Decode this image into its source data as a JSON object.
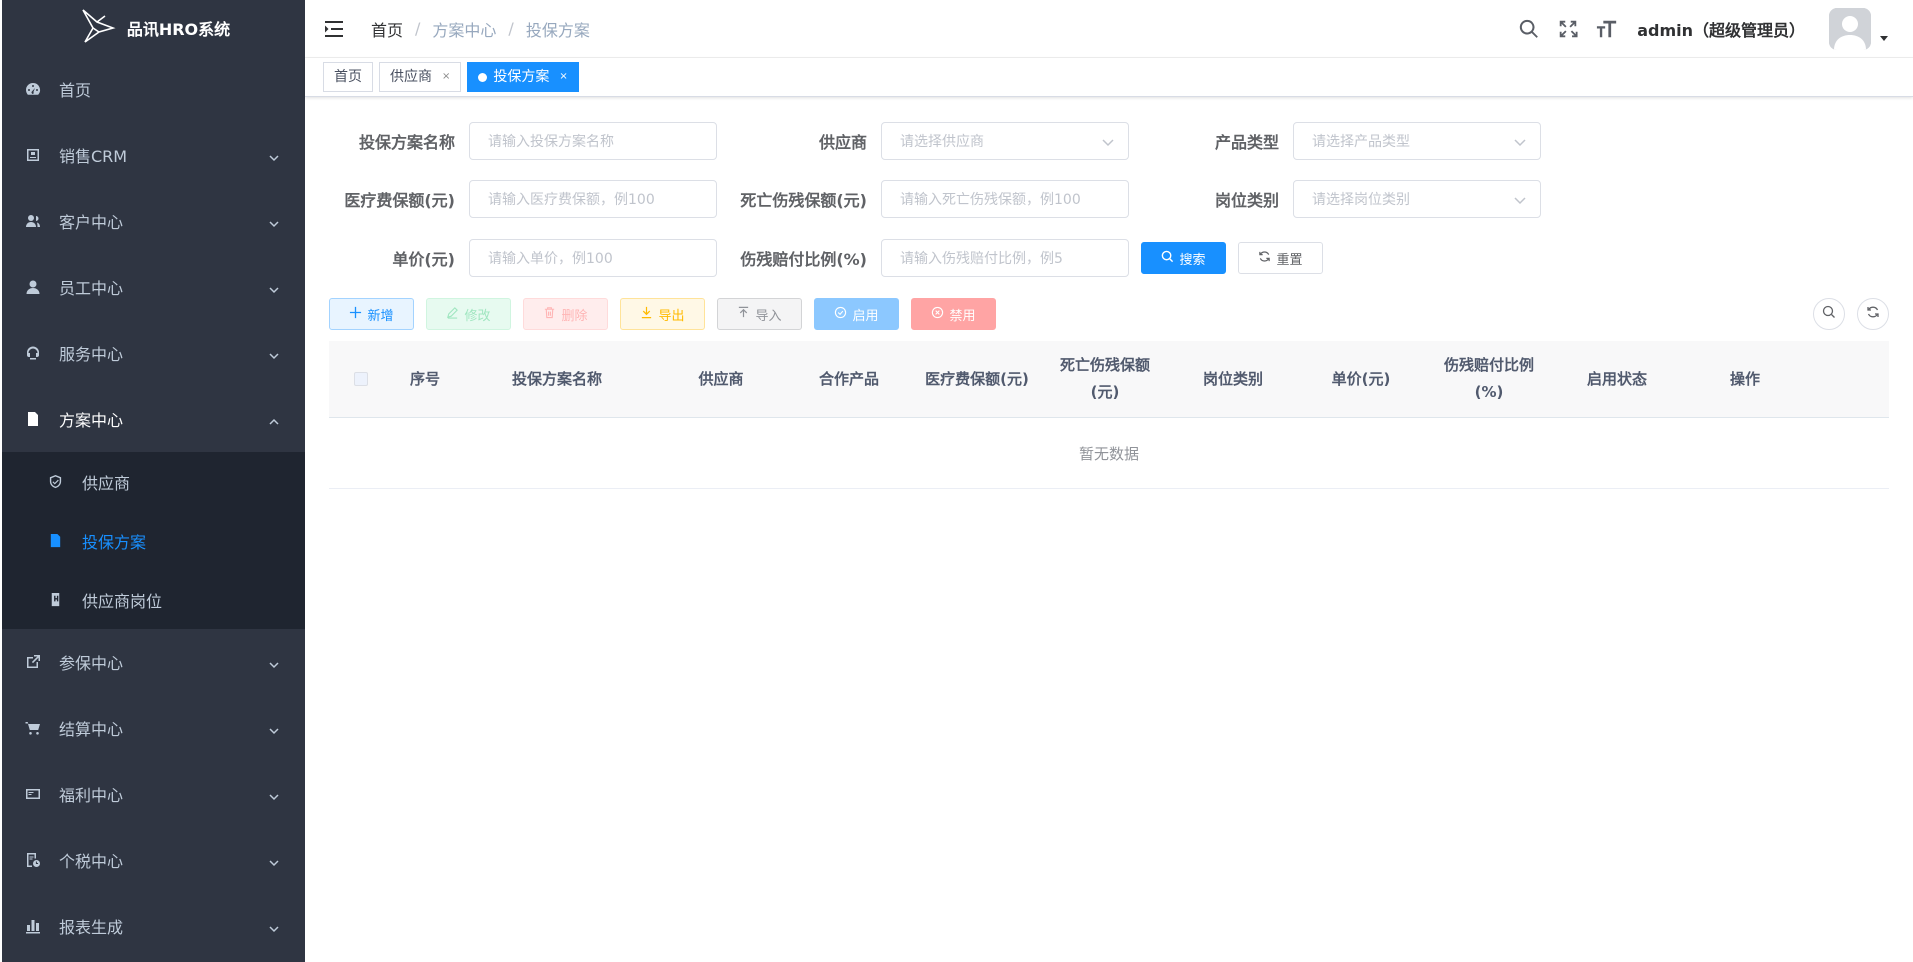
{
  "app": {
    "title": "品讯HRO系统"
  },
  "sidebar": {
    "items": [
      {
        "label": "首页",
        "icon": "dashboard-icon",
        "has_children": false
      },
      {
        "label": "销售CRM",
        "icon": "crm-icon",
        "has_children": true
      },
      {
        "label": "客户中心",
        "icon": "customers-icon",
        "has_children": true
      },
      {
        "label": "员工中心",
        "icon": "user-icon",
        "has_children": true
      },
      {
        "label": "服务中心",
        "icon": "service-icon",
        "has_children": true
      },
      {
        "label": "方案中心",
        "icon": "document-icon",
        "has_children": true,
        "open": true,
        "children": [
          {
            "label": "供应商",
            "icon": "shield-icon"
          },
          {
            "label": "投保方案",
            "icon": "file-icon",
            "active": true
          },
          {
            "label": "供应商岗位",
            "icon": "badge-icon"
          }
        ]
      },
      {
        "label": "参保中心",
        "icon": "external-link-icon",
        "has_children": true
      },
      {
        "label": "结算中心",
        "icon": "cart-icon",
        "has_children": true
      },
      {
        "label": "福利中心",
        "icon": "card-icon",
        "has_children": true
      },
      {
        "label": "个税中心",
        "icon": "tax-icon",
        "has_children": true
      },
      {
        "label": "报表生成",
        "icon": "bar-chart-icon",
        "has_children": true
      }
    ]
  },
  "navbar": {
    "breadcrumb": [
      "首页",
      "方案中心",
      "投保方案"
    ],
    "user": "admin（超级管理员）"
  },
  "tags": [
    {
      "label": "首页",
      "closable": false,
      "active": false
    },
    {
      "label": "供应商",
      "closable": true,
      "active": false
    },
    {
      "label": "投保方案",
      "closable": true,
      "active": true
    }
  ],
  "form": {
    "plan_name": {
      "label": "投保方案名称",
      "placeholder": "请输入投保方案名称"
    },
    "supplier": {
      "label": "供应商",
      "placeholder": "请选择供应商"
    },
    "product_type": {
      "label": "产品类型",
      "placeholder": "请选择产品类型"
    },
    "medical": {
      "label": "医疗费保额(元)",
      "placeholder": "请输入医疗费保额，例100"
    },
    "death": {
      "label": "死亡伤残保额(元)",
      "placeholder": "请输入死亡伤残保额，例100"
    },
    "position": {
      "label": "岗位类别",
      "placeholder": "请选择岗位类别"
    },
    "price": {
      "label": "单价(元)",
      "placeholder": "请输入单价，例100"
    },
    "ratio": {
      "label": "伤残赔付比例(%)",
      "placeholder": "请输入伤残赔付比例，例5"
    },
    "search_btn": "搜索",
    "reset_btn": "重置"
  },
  "toolbar": {
    "add": "新增",
    "edit": "修改",
    "delete": "删除",
    "export": "导出",
    "import": "导入",
    "enable": "启用",
    "disable": "禁用"
  },
  "table": {
    "columns": [
      {
        "line1": "序号",
        "line2": ""
      },
      {
        "line1": "投保方案名称",
        "line2": ""
      },
      {
        "line1": "供应商",
        "line2": ""
      },
      {
        "line1": "合作产品",
        "line2": ""
      },
      {
        "line1": "医疗费保额(元)",
        "line2": ""
      },
      {
        "line1": "死亡伤残保额",
        "line2": "(元)"
      },
      {
        "line1": "岗位类别",
        "line2": ""
      },
      {
        "line1": "单价(元)",
        "line2": ""
      },
      {
        "line1": "伤残赔付比例",
        "line2": "(%)"
      },
      {
        "line1": "启用状态",
        "line2": ""
      },
      {
        "line1": "操作",
        "line2": ""
      }
    ],
    "empty_text": "暂无数据"
  },
  "colors": {
    "primary": "#1890ff",
    "sidebar_bg": "#2f3542",
    "submenu_bg": "#1f2530"
  }
}
